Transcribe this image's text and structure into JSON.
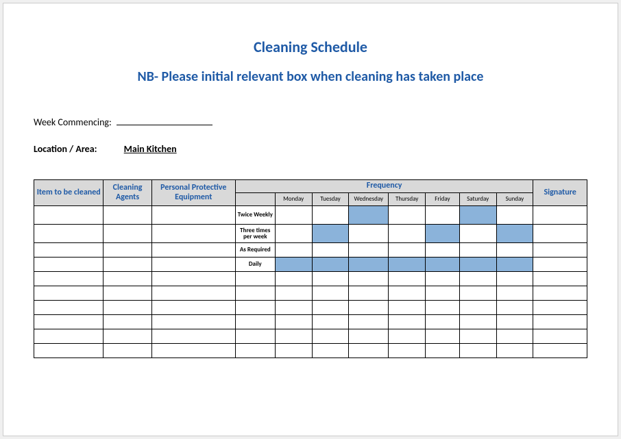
{
  "chart_data": {
    "type": "table",
    "title": "Cleaning Schedule",
    "subtitle": "NB- Please initial relevant box when cleaning has taken place",
    "week_commencing": "",
    "location": "Main Kitchen",
    "columns": [
      "Item to be cleaned",
      "Cleaning Agents",
      "Personal Protective Equipment",
      "Frequency",
      "Monday",
      "Tuesday",
      "Wednesday",
      "Thursday",
      "Friday",
      "Saturday",
      "Sunday",
      "Signature"
    ],
    "rows": [
      {
        "freq": "Twice Weekly",
        "marks": {
          "Monday": false,
          "Tuesday": false,
          "Wednesday": true,
          "Thursday": false,
          "Friday": false,
          "Saturday": true,
          "Sunday": false
        }
      },
      {
        "freq": "Three times per week",
        "marks": {
          "Monday": false,
          "Tuesday": true,
          "Wednesday": false,
          "Thursday": false,
          "Friday": true,
          "Saturday": false,
          "Sunday": true
        }
      },
      {
        "freq": "As Required",
        "marks": {
          "Monday": false,
          "Tuesday": false,
          "Wednesday": false,
          "Thursday": false,
          "Friday": false,
          "Saturday": false,
          "Sunday": false
        }
      },
      {
        "freq": "Daily",
        "marks": {
          "Monday": true,
          "Tuesday": true,
          "Wednesday": true,
          "Thursday": true,
          "Friday": true,
          "Saturday": true,
          "Sunday": true
        }
      }
    ]
  },
  "title": "Cleaning Schedule",
  "subtitle": "NB- Please initial relevant box when cleaning has taken place",
  "week_commencing_label": "Week Commencing:",
  "location_label": "Location / Area:",
  "location_value": "Main Kitchen",
  "headers": {
    "item": "Item to be cleaned",
    "agents": "Cleaning Agents",
    "ppe": "Personal Protective Equipment",
    "frequency": "Frequency",
    "signature": "Signature",
    "days": [
      "Monday",
      "Tuesday",
      "Wednesday",
      "Thursday",
      "Friday",
      "Saturday",
      "Sunday"
    ]
  },
  "freq_labels": [
    "Twice Weekly",
    "Three times per week",
    "As Required",
    "Daily"
  ]
}
